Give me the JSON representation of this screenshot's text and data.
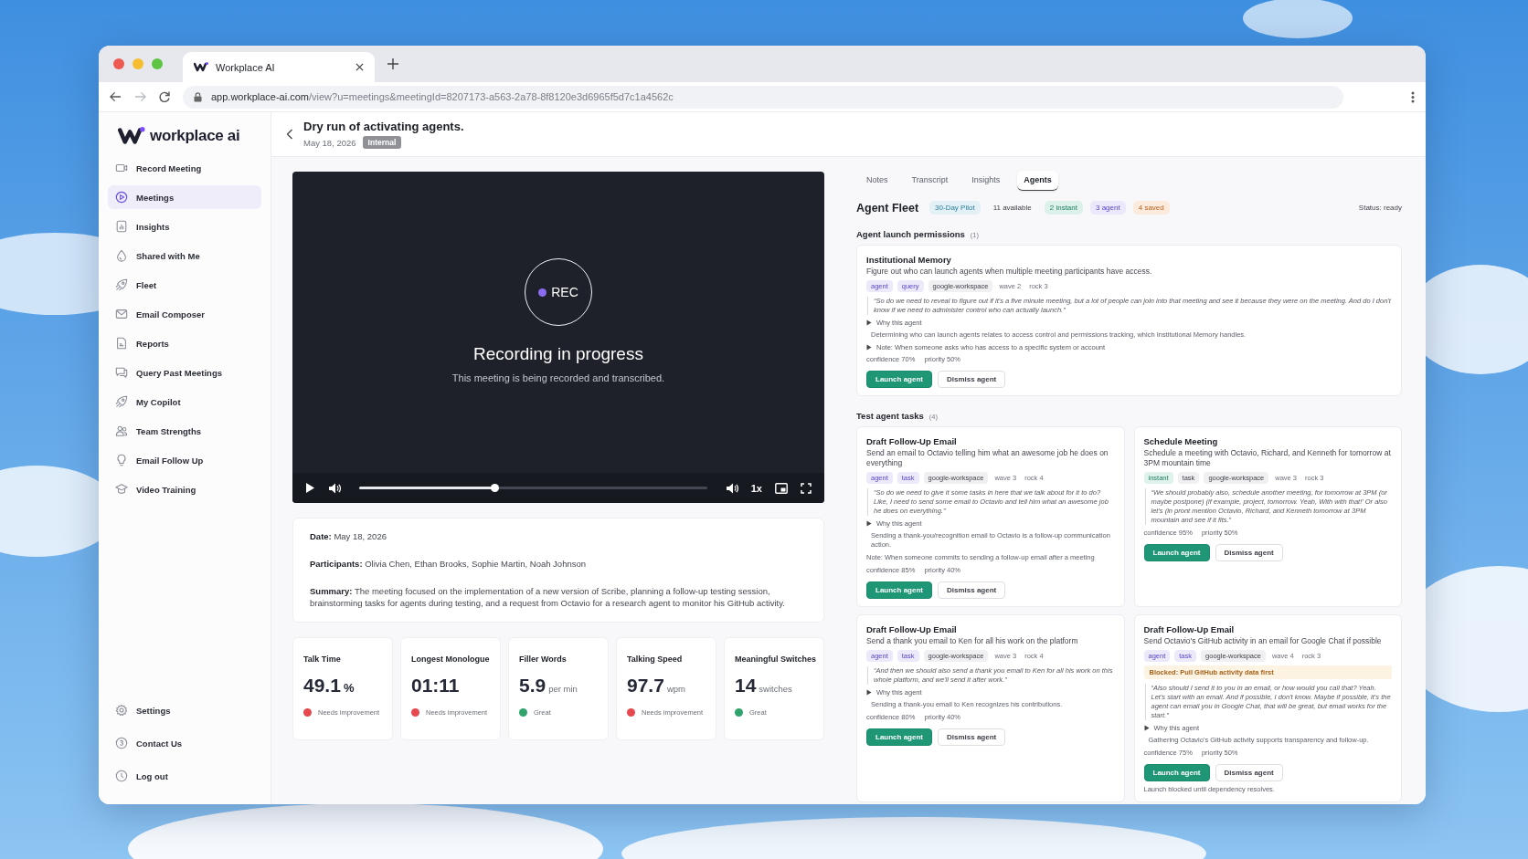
{
  "browser": {
    "tab_title": "Workplace AI",
    "url_host": "app.workplace-ai.com",
    "url_path": "/view?u=meetings&meetingId=8207173-a563-2a78-8f8120e3d6965f5d7c1a4562c"
  },
  "sidebar": {
    "logo": "workplace ai",
    "items": [
      {
        "label": "Record Meeting",
        "selected": false
      },
      {
        "label": "Meetings",
        "selected": true
      },
      {
        "label": "Insights",
        "selected": false
      },
      {
        "label": "Shared with Me",
        "selected": false
      },
      {
        "label": "Fleet",
        "selected": false
      },
      {
        "label": "Email Composer",
        "selected": false
      },
      {
        "label": "Reports",
        "selected": false
      },
      {
        "label": "Query Past Meetings",
        "selected": false
      },
      {
        "label": "My Copilot",
        "selected": false
      },
      {
        "label": "Team Strengths",
        "selected": false
      },
      {
        "label": "Email Follow Up",
        "selected": false
      },
      {
        "label": "Video Training",
        "selected": false
      }
    ],
    "footer_items": [
      {
        "label": "Settings",
        "selected": false
      },
      {
        "label": "Contact Us",
        "selected": false
      },
      {
        "label": "Log out",
        "selected": false
      }
    ]
  },
  "header": {
    "title": "Dry run of activating agents.",
    "date": "May 18, 2026",
    "badge": "Internal"
  },
  "video": {
    "rec_label": "REC",
    "heading": "Recording in progress",
    "subtext": "This meeting is being recorded and transcribed.",
    "level": 0.39,
    "speed": "1x"
  },
  "details": [
    "**Date:** May 18, 2026",
    "**Participants:** Olivia Chen, Ethan Brooks, Sophie Martin, Noah Johnson",
    "**Summary:** The meeting focused on the implementation of a new version of Scribe, planning a follow-up testing session, brainstorming tasks for agents during testing, and a request from Octavio for a research agent to monitor his GitHub activity."
  ],
  "stats": [
    {
      "title": "Talk Time",
      "value": "49.1",
      "unit": "%",
      "status": "Needs improvement",
      "color": "#e5484d"
    },
    {
      "title": "Longest Monologue",
      "value": "01:11",
      "status": "Needs improvement",
      "color": "#e5484d"
    },
    {
      "title": "Filler Words",
      "value": "5.9",
      "unit": "per min",
      "status": "Great",
      "color": "#30a46c"
    },
    {
      "title": "Talking Speed",
      "value": "97.7",
      "unit": "wpm",
      "status": "Needs improvement",
      "color": "#e5484d"
    },
    {
      "title": "Meaningful Switches",
      "value": "14",
      "unit": "switches",
      "status": "Great",
      "color": "#30a46c"
    }
  ],
  "tabs": [
    {
      "label": "Notes",
      "selected": false
    },
    {
      "label": "Transcript",
      "selected": false
    },
    {
      "label": "Insights",
      "selected": false
    },
    {
      "label": "Agents",
      "selected": true
    }
  ],
  "fleet": {
    "title": "Agent Fleet",
    "badges": [
      {
        "text": "30-Day Pilot",
        "kind": "pilot"
      },
      {
        "text": "11 available",
        "kind": "count"
      },
      {
        "text": "2 instant",
        "kind": "instant"
      },
      {
        "text": "3 agent",
        "kind": "agent"
      },
      {
        "text": "4 saved",
        "kind": "saved"
      }
    ],
    "status": "Status: ready"
  },
  "permissions": {
    "heading": "Agent launch permissions",
    "count": "(1)",
    "cards": [
      {
        "title": "Institutional Memory",
        "description": "Figure out who can launch agents when multiple meeting participants have access.",
        "tags": [
          {
            "text": "agent",
            "kind": "type"
          },
          {
            "text": "query",
            "kind": "type"
          },
          {
            "text": "google-workspace",
            "kind": "neutral"
          },
          {
            "text": "wave 2",
            "kind": "meta"
          },
          {
            "text": "rock 3",
            "kind": "meta"
          }
        ],
        "quote": "“So do we need to reveal to figure out if it's a five minute meeting, but a lot of people can join into that meeting and see it because they were on the meeting. And do I don't know if we need to administer control who can actually launch.”",
        "why": {
          "label": "Why this agent",
          "text": "Determining who can launch agents relates to access control and permissions tracking, which Institutional Memory handles."
        },
        "note": {
          "text": "Note: When someone asks who has access to a specific system or account",
          "kind": "toggle"
        },
        "metrics": [
          "confidence 70%",
          "priority 50%"
        ],
        "buttons": [
          {
            "label": "Launch agent",
            "kind": "primary"
          },
          {
            "label": "Dismiss agent",
            "kind": "secondary"
          }
        ]
      }
    ]
  },
  "tasks": {
    "heading": "Test agent tasks",
    "count": "(4)",
    "cards": [
      {
        "title": "Draft Follow-Up Email",
        "description": "Send an email to Octavio telling him what an awesome job he does on everything",
        "tags": [
          {
            "text": "agent",
            "kind": "type"
          },
          {
            "text": "task",
            "kind": "type"
          },
          {
            "text": "google-workspace",
            "kind": "neutral"
          },
          {
            "text": "wave 3",
            "kind": "meta"
          },
          {
            "text": "rock 4",
            "kind": "meta"
          }
        ],
        "quote": "“So do we need to give it some tasks in here that we talk about for it to do? Like, I need to send some email to Octavio and tell him what an awesome job he does on everything.”",
        "why": {
          "label": "Why this agent",
          "text": "Sending a thank-you/recognition email to Octavio is a follow-up communication action."
        },
        "note": {
          "text": "Note: When someone commits to sending a follow-up email after a meeting",
          "kind": "plain"
        },
        "metrics": [
          "confidence 85%",
          "priority 40%"
        ],
        "buttons": [
          {
            "label": "Launch agent",
            "kind": "primary"
          },
          {
            "label": "Dismiss agent",
            "kind": "secondary"
          }
        ]
      },
      {
        "title": "Schedule Meeting",
        "description": "Schedule a meeting with Octavio, Richard, and Kenneth for tomorrow at 3PM mountain time",
        "tags": [
          {
            "text": "instant",
            "kind": "instant"
          },
          {
            "text": "task",
            "kind": "neutral"
          },
          {
            "text": "google-workspace",
            "kind": "neutral"
          },
          {
            "text": "wave 3",
            "kind": "meta"
          },
          {
            "text": "rock 3",
            "kind": "meta"
          }
        ],
        "quote": "“We should probably also, schedule another meeting, for tomorrow at 3PM (or maybe postpone) (if example, project, tomorrow. Yeah, With with that!' Or also let's (in pront mention Octavio, Richard, and Kenneth tomorrow at 3PM mountain and see if it fits.”",
        "metrics": [
          "confidence 95%",
          "priority 50%"
        ],
        "buttons": [
          {
            "label": "Launch agent",
            "kind": "primary"
          },
          {
            "label": "Dismiss agent",
            "kind": "secondary"
          }
        ]
      },
      {
        "title": "Draft Follow-Up Email",
        "description": "Send a thank you email to Ken for all his work on the platform",
        "tags": [
          {
            "text": "agent",
            "kind": "type"
          },
          {
            "text": "task",
            "kind": "type"
          },
          {
            "text": "google-workspace",
            "kind": "neutral"
          },
          {
            "text": "wave 3",
            "kind": "meta"
          },
          {
            "text": "rock 4",
            "kind": "meta"
          }
        ],
        "quote": "“And then we should also send a thank you email to Ken for all his work on this whole platform, and we'll send it after work.”",
        "why": {
          "label": "Why this agent",
          "text": "Sending a thank-you email to Ken recognizes his contributions."
        },
        "metrics": [
          "confidence 80%",
          "priority 40%"
        ],
        "buttons": [
          {
            "label": "Launch agent",
            "kind": "primary"
          },
          {
            "label": "Dismiss agent",
            "kind": "secondary"
          }
        ]
      },
      {
        "title": "Draft Follow-Up Email",
        "description": "Send Octavio's GitHub activity in an email for Google Chat if possible",
        "tags": [
          {
            "text": "agent",
            "kind": "type"
          },
          {
            "text": "task",
            "kind": "type"
          },
          {
            "text": "google-workspace",
            "kind": "neutral"
          },
          {
            "text": "wave 4",
            "kind": "meta"
          },
          {
            "text": "rock 3",
            "kind": "meta"
          }
        ],
        "blocked": "Blocked: Pull GitHub activity data first",
        "quote": "“Also should I send it to you in an email, or how would you call that? Yeah. Let's start with an email. And if possible, I don't know. Maybe if possible, it's the agent can email you in Google Chat, that will be great, but email works for the start.”",
        "why": {
          "label": "Why this agent",
          "text": "Gathering Octavio's GitHub activity supports transparency and follow-up."
        },
        "metrics": [
          "confidence 75%",
          "priority 50%"
        ],
        "buttons": [
          {
            "label": "Launch agent",
            "kind": "primary"
          },
          {
            "label": "Dismiss agent",
            "kind": "secondary"
          }
        ],
        "footer_note": "Launch blocked until dependency resolves."
      }
    ]
  }
}
